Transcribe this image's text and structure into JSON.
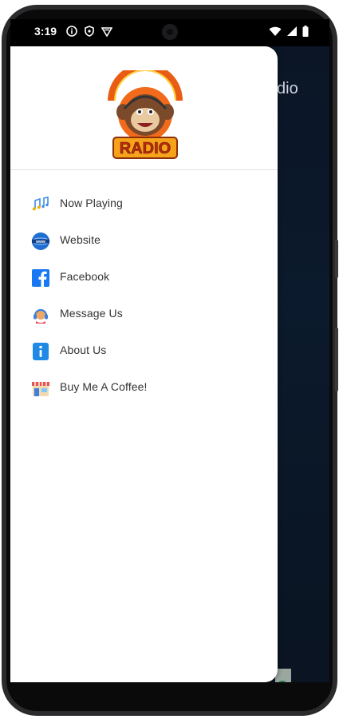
{
  "status_bar": {
    "time": "3:19"
  },
  "background_app": {
    "title_fragment": "dio"
  },
  "drawer": {
    "logo_text": "RADIO",
    "menu": [
      {
        "label": "Now Playing",
        "icon": "music-notes-icon"
      },
      {
        "label": "Website",
        "icon": "globe-www-icon"
      },
      {
        "label": "Facebook",
        "icon": "facebook-icon"
      },
      {
        "label": "Message Us",
        "icon": "headset-support-icon"
      },
      {
        "label": "About Us",
        "icon": "info-icon"
      },
      {
        "label": "Buy Me A Coffee!",
        "icon": "store-icon"
      }
    ]
  },
  "colors": {
    "drawer_bg": "#ffffff",
    "app_bg": "#0b1526",
    "menu_text": "#333333",
    "facebook_blue": "#1877f2",
    "logo_orange": "#f26a1b"
  }
}
